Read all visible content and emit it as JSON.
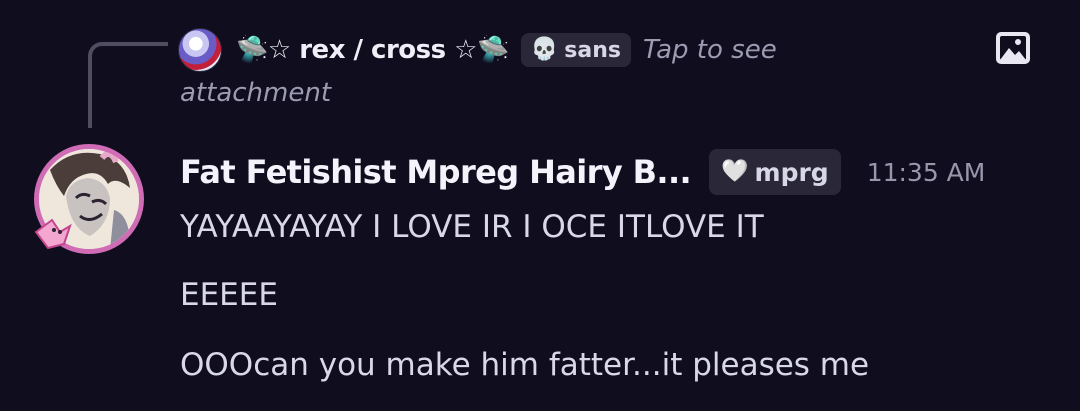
{
  "reply": {
    "author": "🛸☆ rex / cross ☆🛸",
    "tag": {
      "icon": "💀",
      "label": "sans"
    },
    "preview_line1": "Tap to see",
    "preview_line2": "attachment",
    "attachment_icon": "image-icon"
  },
  "message": {
    "author": "Fat Fetishist Mpreg Hairy B...",
    "tag": {
      "icon": "🤍",
      "label": "mprg"
    },
    "timestamp": "11:35 AM",
    "lines": [
      "YAYAAYAYAY I LOVE IR I OCE ITLOVE IT",
      "EEEEE",
      "OOOcan you make him fatter...it pleases me"
    ]
  },
  "colors": {
    "background": "#100e1e",
    "tag_background": "#2a2838",
    "avatar_ring": "#d06bb6"
  }
}
